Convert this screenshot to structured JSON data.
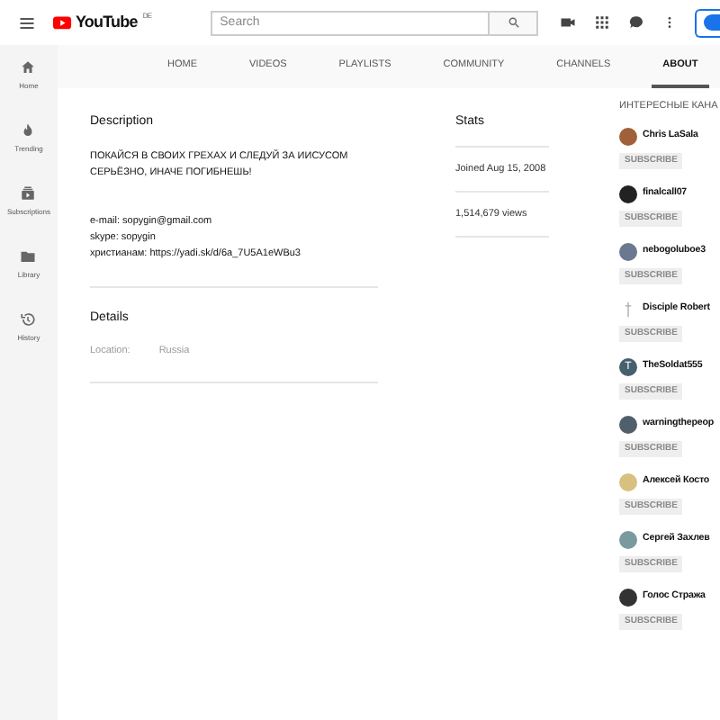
{
  "topbar": {
    "logo": "YouTube",
    "logo_country": "DE",
    "search": {
      "placeholder": "Search"
    }
  },
  "sidebar": {
    "items": [
      {
        "label": "Home",
        "kind": "home"
      },
      {
        "label": "Trending",
        "kind": "trending"
      },
      {
        "label": "Subscriptions",
        "kind": "subscriptions"
      },
      {
        "label": "Library",
        "kind": "library"
      },
      {
        "label": "History",
        "kind": "history"
      }
    ]
  },
  "tabs": [
    {
      "label": "HOME",
      "selected": false
    },
    {
      "label": "VIDEOS",
      "selected": false
    },
    {
      "label": "PLAYLISTS",
      "selected": false
    },
    {
      "label": "COMMUNITY",
      "selected": false
    },
    {
      "label": "CHANNELS",
      "selected": false
    },
    {
      "label": "ABOUT",
      "selected": true
    }
  ],
  "description": {
    "title": "Description",
    "lines": [
      "ПОКАЙСЯ В СВОИХ ГРЕХАХ И СЛЕДУЙ ЗА ИИСУСОМ",
      "СЕРЬЁЗНО, ИНАЧЕ ПОГИБНЕШЬ!"
    ],
    "contacts": [
      "e-mail: sopygin@gmail.com",
      "skype: sopygin",
      "христианам: https://yadi.sk/d/6a_7U5A1eWBu3"
    ]
  },
  "details": {
    "title": "Details",
    "location_label": "Location:",
    "location": "Russia"
  },
  "stats": {
    "title": "Stats",
    "joined": "Joined Aug 15, 2008",
    "views": "1,514,679 views"
  },
  "channels": {
    "title": "ИНТЕРЕСНЫЕ КАНА",
    "items": [
      {
        "name": "Chris LaSala",
        "kind": "avatar",
        "button": "SUBSCRIBE"
      },
      {
        "name": "finalcall07",
        "kind": "avatar",
        "button": "SUBSCRIBE"
      },
      {
        "name": "nebogoluboe3",
        "kind": "avatar",
        "button": "SUBSCRIBE"
      },
      {
        "name": "Disciple Robert",
        "kind": "cross",
        "button": "SUBSCRIBE"
      },
      {
        "name": "TheSoldat555",
        "kind": "letter",
        "initial": "T",
        "button": "SUBSCRIBE"
      },
      {
        "name": "warningthepeop",
        "kind": "avatar",
        "button": "SUBSCRIBE"
      },
      {
        "name": "Алексей Косто",
        "kind": "avatar",
        "button": "SUBSCRIBE"
      },
      {
        "name": "Сергей Захлев",
        "kind": "avatar",
        "button": "SUBSCRIBE"
      },
      {
        "name": "Голос Стража",
        "kind": "avatar",
        "button": "SUBSCRIBE"
      }
    ]
  }
}
